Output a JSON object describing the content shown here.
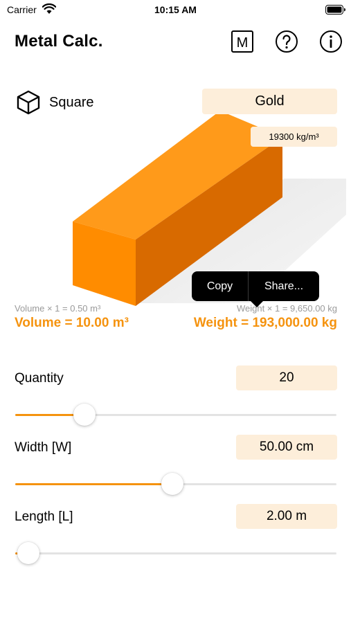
{
  "status_bar": {
    "carrier": "Carrier",
    "time": "10:15 AM"
  },
  "nav": {
    "title": "Metal Calc.",
    "m_button_label": "M",
    "help_icon": "question-circle-icon",
    "info_icon": "info-circle-icon"
  },
  "shape": {
    "label": "Square",
    "icon": "cube-icon"
  },
  "material": {
    "name": "Gold",
    "density": "19300 kg/m³"
  },
  "results": {
    "volume_single": "Volume × 1 = 0.50 m³",
    "weight_single": "Weight × 1 = 9,650.00 kg",
    "volume_total": "Volume = 10.00 m³",
    "weight_total": "Weight = 193,000.00 kg"
  },
  "context_menu": {
    "copy": "Copy",
    "share": "Share..."
  },
  "params": [
    {
      "label": "Quantity",
      "value": "20",
      "slider_fraction": 0.215
    },
    {
      "label": "Width [W]",
      "value": "50.00 cm",
      "slider_fraction": 0.49
    },
    {
      "label": "Length [L]",
      "value": "2.00 m",
      "slider_fraction": 0.04
    }
  ],
  "colors": {
    "accent": "#f5930f",
    "field_bg": "#fdeeda",
    "bar_front": "#ff8c00",
    "bar_top": "#ff9a1a",
    "bar_side": "#d86a00"
  }
}
